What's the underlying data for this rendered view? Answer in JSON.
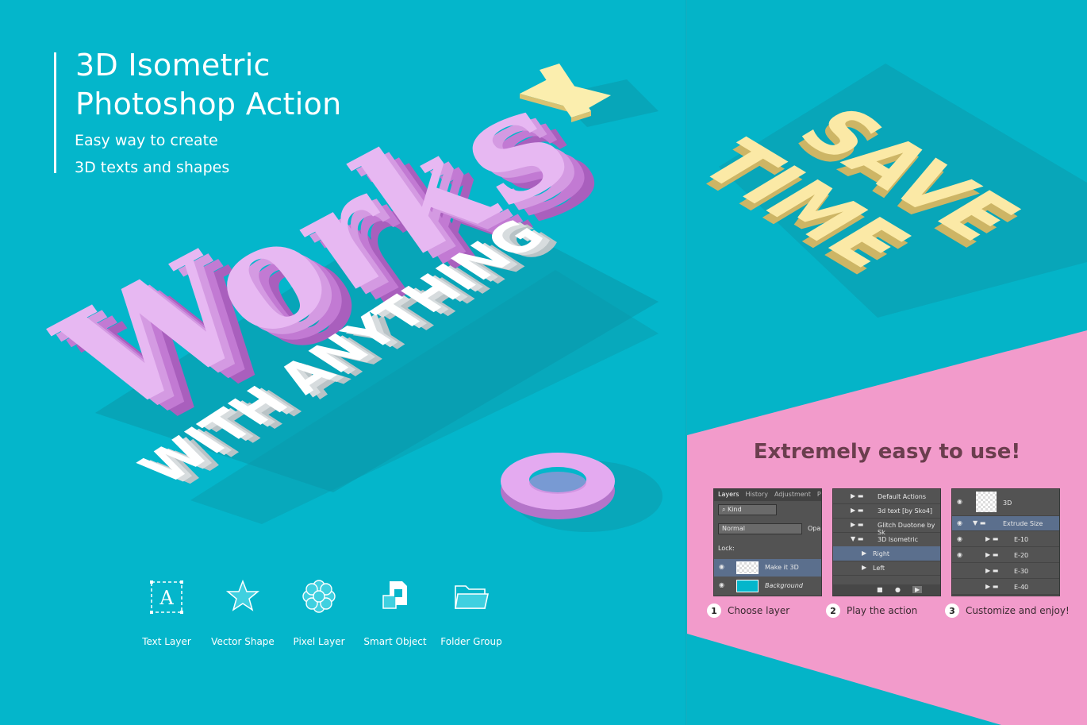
{
  "left": {
    "title_line1": "3D Isometric",
    "title_line2": "Photoshop Action",
    "subtitle_line1": "Easy way to create",
    "subtitle_line2": "3D texts and shapes",
    "art_word": "Works",
    "art_phrase": "WITH ANYTHING",
    "layer_types": [
      {
        "label": "Text Layer",
        "icon": "text-layer-icon"
      },
      {
        "label": "Vector Shape",
        "icon": "vector-shape-icon"
      },
      {
        "label": "Pixel Layer",
        "icon": "pixel-layer-icon"
      },
      {
        "label": "Smart Object",
        "icon": "smart-object-icon"
      },
      {
        "label": "Folder Group",
        "icon": "folder-group-icon"
      }
    ]
  },
  "right": {
    "art_line1": "SAVE",
    "art_line2": "TIME",
    "easy_title": "Extremely easy to use!",
    "layers_panel": {
      "tabs": [
        "Layers",
        "History",
        "Adjustment",
        "P"
      ],
      "kind": "Kind",
      "blend": "Normal",
      "opacity": "Opa",
      "lock": "Lock:",
      "layers": [
        "Make it 3D",
        "Background"
      ]
    },
    "actions_panel": {
      "items": [
        "Default Actions",
        "3d text [by Sko4]",
        "Glitch Duotone by Sk",
        "3D Isometric",
        "Right",
        "Left"
      ]
    },
    "extrude_panel": {
      "items": [
        "3D",
        "Extrude Size",
        "E-10",
        "E-20",
        "E-30",
        "E-40"
      ]
    },
    "steps": [
      {
        "num": "1",
        "label": "Choose layer"
      },
      {
        "num": "2",
        "label": "Play the action"
      },
      {
        "num": "3",
        "label": "Customize and enjoy!"
      }
    ]
  },
  "colors": {
    "teal": "#04b6cb",
    "pink": "#f19ac8",
    "purple_3d": "#d98ee6",
    "yellow_3d": "#f8e39a",
    "white_3d": "#f5f5f5"
  }
}
